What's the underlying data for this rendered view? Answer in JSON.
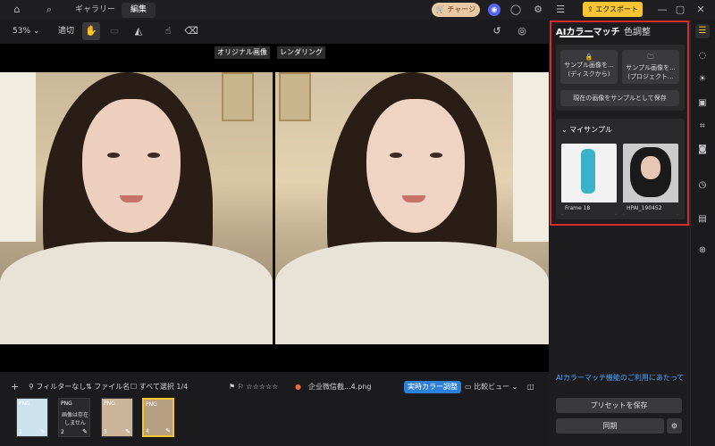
{
  "titlebar": {
    "tabs": [
      "ギャラリー",
      "編集"
    ],
    "charge_label": "チャージ",
    "export_label": "エクスポート"
  },
  "toolbar": {
    "zoom": "53%",
    "fit_label": "適切"
  },
  "canvas": {
    "original_label": "オリジナル画像",
    "render_label": "レンダリング"
  },
  "bottombar": {
    "filter_label": "フィルターなし",
    "filename_sort_label": "ファイル名",
    "select_all_label": "すべて選択 1/4",
    "file_name": "企业微信截...4.png",
    "realtime_label": "実時カラー調整",
    "compare_label": "比較ビュー",
    "thumbnails": [
      {
        "tag": "PNG",
        "num": "1"
      },
      {
        "tag": "PNG",
        "num": "2",
        "note": "画像は存在しません"
      },
      {
        "tag": "PNG",
        "num": "3"
      },
      {
        "tag": "PNG",
        "num": "4"
      }
    ]
  },
  "panel": {
    "tabs": [
      "AIカラーマッチ",
      "色調整"
    ],
    "sample_disk_line1": "サンプル画像を...",
    "sample_disk_line2": "(ディスクから)",
    "sample_project_line1": "サンプル画像を...",
    "sample_project_line2": "(プロジェクト...",
    "save_current_label": "現在の画像をサンプルとして保存",
    "my_samples_label": "マイサンプル",
    "samples": [
      {
        "caption": "Frame 18"
      },
      {
        "caption": "HPAI_190452"
      }
    ],
    "notice": "AIカラーマッチ機能のご利用にあたって",
    "save_preset_label": "プリセットを保存",
    "sync_label": "同期"
  }
}
